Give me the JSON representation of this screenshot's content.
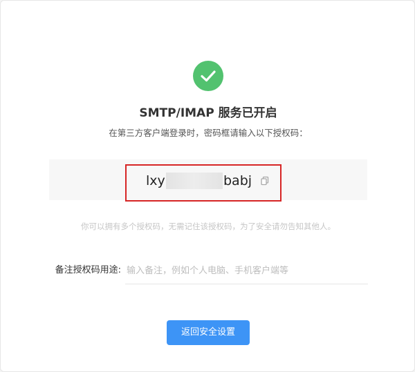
{
  "dialog": {
    "title": "SMTP/IMAP 服务已开启",
    "subtitle": "在第三方客户端登录时，密码框请输入以下授权码："
  },
  "auth_code": {
    "visible_start": "lxy",
    "visible_end": "babj",
    "masked": true,
    "copy_icon": "copy-icon"
  },
  "hint": "你可以拥有多个授权码，无需记住该授权码，为了安全请勿告知其他人。",
  "note": {
    "label": "备注授权码用途:",
    "value": "",
    "placeholder": "输入备注，例如个人电脑、手机客户端等"
  },
  "back_button_label": "返回安全设置",
  "colors": {
    "success": "#52c26f",
    "highlight_border": "#d62424",
    "primary_button": "#3d94f6"
  }
}
